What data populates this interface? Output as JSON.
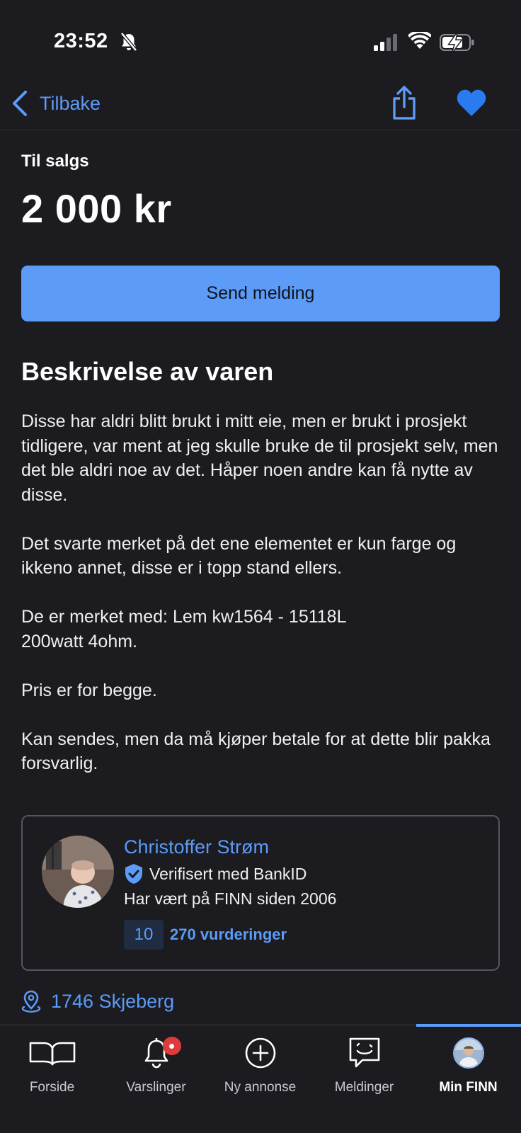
{
  "status_bar": {
    "time": "23:52"
  },
  "nav": {
    "back_label": "Tilbake"
  },
  "listing": {
    "status": "Til salgs",
    "price": "2 000 kr",
    "send_button": "Send melding",
    "description_title": "Beskrivelse av varen",
    "description": [
      "Disse har aldri blitt brukt i mitt eie, men er brukt i prosjekt tidligere, var ment at jeg skulle bruke de til prosjekt selv, men det ble aldri noe av det. Håper noen andre kan få nytte av disse.",
      "Det svarte merket på det ene elementet er kun farge og ikkeno annet, disse er i topp stand ellers.",
      "De er merket med: Lem kw1564 - 15118L",
      "200watt 4ohm.",
      "Pris er for begge.",
      "Kan sendes, men da må kjøper betale for at dette blir pakka forsvarlig."
    ]
  },
  "seller": {
    "name": "Christoffer Strøm",
    "verified": "Verifisert med BankID",
    "member_since": "Har vært på FINN siden 2006",
    "rating_score": "10",
    "rating_count": "270 vurderinger"
  },
  "location": "1746 Skjeberg",
  "tabbar": {
    "items": [
      {
        "label": "Forside",
        "icon": "book-icon"
      },
      {
        "label": "Varslinger",
        "icon": "bell-icon"
      },
      {
        "label": "Ny annonse",
        "icon": "plus-circle-icon"
      },
      {
        "label": "Meldinger",
        "icon": "chat-icon"
      },
      {
        "label": "Min FINN",
        "icon": "profile-avatar"
      }
    ],
    "active_index": 4
  },
  "colors": {
    "background": "#1b1b20",
    "accent": "#5c9bf7",
    "badge": "#e03a3a",
    "text": "#ffffff"
  }
}
